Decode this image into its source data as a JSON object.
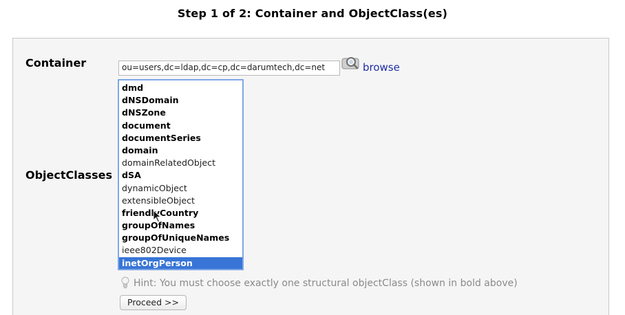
{
  "header": {
    "step_title": "Step 1 of 2: Container and ObjectClass(es)"
  },
  "container": {
    "label": "Container",
    "value": "ou=users,dc=ldap,dc=cp,dc=darumtech,dc=net",
    "browse_label": "browse",
    "browse_icon": "magnifier-icon"
  },
  "objectclasses": {
    "label": "ObjectClasses",
    "selected": "inetOrgPerson",
    "items": [
      {
        "name": "dmd",
        "structural": true,
        "selected": false
      },
      {
        "name": "dNSDomain",
        "structural": true,
        "selected": false
      },
      {
        "name": "dNSZone",
        "structural": true,
        "selected": false
      },
      {
        "name": "document",
        "structural": true,
        "selected": false
      },
      {
        "name": "documentSeries",
        "structural": true,
        "selected": false
      },
      {
        "name": "domain",
        "structural": true,
        "selected": false
      },
      {
        "name": "domainRelatedObject",
        "structural": false,
        "selected": false
      },
      {
        "name": "dSA",
        "structural": true,
        "selected": false
      },
      {
        "name": "dynamicObject",
        "structural": false,
        "selected": false
      },
      {
        "name": "extensibleObject",
        "structural": false,
        "selected": false
      },
      {
        "name": "friendlyCountry",
        "structural": true,
        "selected": false
      },
      {
        "name": "groupOfNames",
        "structural": true,
        "selected": false
      },
      {
        "name": "groupOfUniqueNames",
        "structural": true,
        "selected": false
      },
      {
        "name": "ieee802Device",
        "structural": false,
        "selected": false
      },
      {
        "name": "inetOrgPerson",
        "structural": true,
        "selected": true
      }
    ]
  },
  "hint": {
    "text": "Hint: You must choose exactly one structural objectClass (shown in bold above)",
    "icon": "lightbulb-icon"
  },
  "actions": {
    "proceed_label": "Proceed >>"
  },
  "colors": {
    "link": "#1f2fa3",
    "selection": "#3875d7",
    "list_focus_border": "#7fa7e6",
    "hint_text": "#8a8a8a",
    "panel_bg": "#f5f5f5"
  }
}
